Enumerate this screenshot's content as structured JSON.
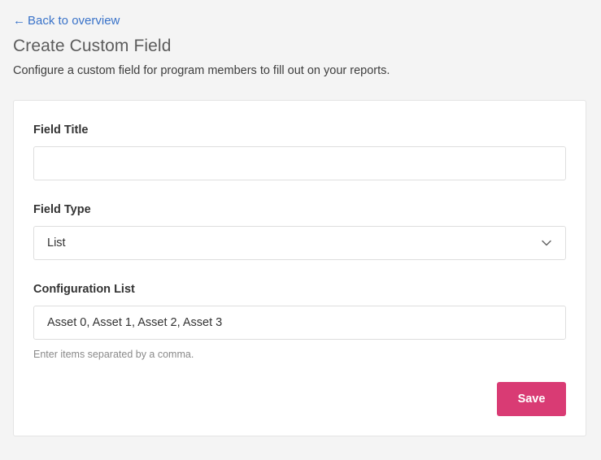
{
  "nav": {
    "back_arrow": "←",
    "back_label": "Back to overview"
  },
  "header": {
    "title": "Create Custom Field",
    "description": "Configure a custom field for program members to fill out on your reports."
  },
  "form": {
    "field_title": {
      "label": "Field Title",
      "value": "",
      "placeholder": ""
    },
    "field_type": {
      "label": "Field Type",
      "selected": "List",
      "icon": "chevron-down-icon"
    },
    "configuration_list": {
      "label": "Configuration List",
      "value": "Asset 0, Asset 1, Asset 2, Asset 3",
      "help": "Enter items separated by a comma."
    },
    "save_label": "Save"
  },
  "colors": {
    "link": "#3a73c9",
    "accent": "#d93b74",
    "background": "#f4f4f4",
    "card": "#ffffff"
  }
}
